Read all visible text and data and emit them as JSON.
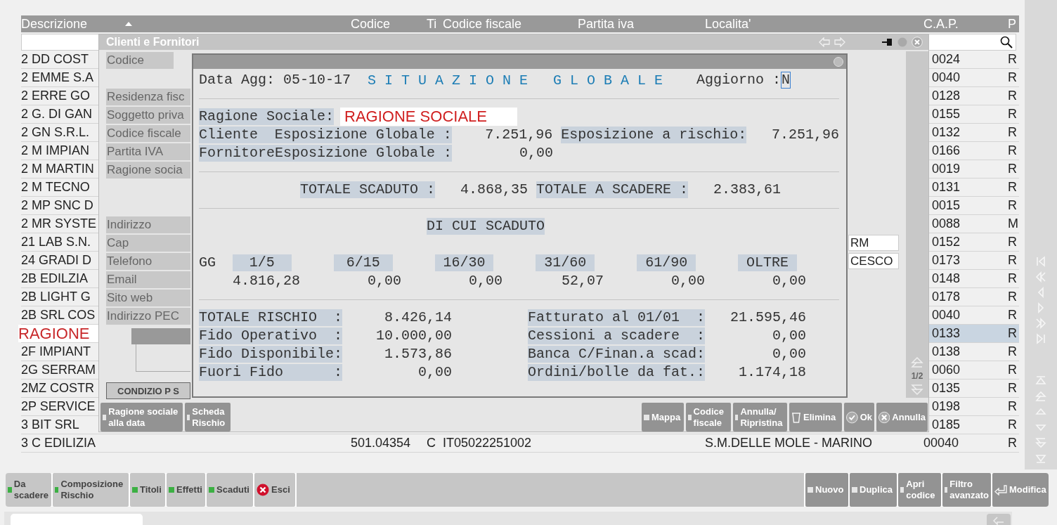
{
  "table": {
    "columns": [
      {
        "label": "Descrizione",
        "sorted": true
      },
      {
        "label": "Codice",
        "sorted": false
      },
      {
        "label": "Ti",
        "sorted": false
      },
      {
        "label": "Codice fiscale",
        "sorted": false
      },
      {
        "label": "Partita iva",
        "sorted": false
      },
      {
        "label": "Localita'",
        "sorted": false
      },
      {
        "label": "C.A.P.",
        "sorted": false
      },
      {
        "label": "P",
        "sorted": false
      }
    ],
    "rows": [
      {
        "description": "2 DD COST",
        "postal_code": "0024",
        "province": "R",
        "selected": false
      },
      {
        "description": "2 EMME S.A",
        "postal_code": "0040",
        "province": "R",
        "selected": false
      },
      {
        "description": "2 ERRE GO",
        "postal_code": "0128",
        "province": "R",
        "selected": false
      },
      {
        "description": "2 G. DI GAN",
        "postal_code": "0155",
        "province": "R",
        "selected": false
      },
      {
        "description": "2 GN S.R.L.",
        "postal_code": "0132",
        "province": "R",
        "selected": false
      },
      {
        "description": "2 M IMPIAN",
        "postal_code": "0166",
        "province": "R",
        "selected": false
      },
      {
        "description": "2 M MARTIN",
        "postal_code": "0019",
        "province": "R",
        "selected": false
      },
      {
        "description": "2 M TECNO",
        "postal_code": "0131",
        "province": "R",
        "selected": false
      },
      {
        "description": "2 MP SNC D",
        "postal_code": "0015",
        "province": "R",
        "selected": false
      },
      {
        "description": "2 MR SYSTE",
        "postal_code": "0088",
        "province": "M",
        "selected": false
      },
      {
        "description": "21 LAB S.N.",
        "postal_code": "0152",
        "province": "R",
        "selected": false
      },
      {
        "description": "24 GRADI D",
        "postal_code": "0173",
        "province": "R",
        "selected": false
      },
      {
        "description": "2B EDILZIA",
        "postal_code": "0148",
        "province": "R",
        "selected": false
      },
      {
        "description": "2B LIGHT G",
        "postal_code": "0178",
        "province": "R",
        "selected": false
      },
      {
        "description": "2B SRL COS",
        "postal_code": "0040",
        "province": "R",
        "selected": false
      },
      {
        "description": "RAGIONE",
        "postal_code": "0133",
        "province": "R",
        "selected": true
      },
      {
        "description": "2F IMPIANT",
        "postal_code": "0138",
        "province": "R",
        "selected": false
      },
      {
        "description": "2G SERRAM",
        "postal_code": "0060",
        "province": "R",
        "selected": false
      },
      {
        "description": "2MZ COSTR",
        "postal_code": "0135",
        "province": "R",
        "selected": false
      },
      {
        "description": "2P SERVICE",
        "postal_code": "0198",
        "province": "R",
        "selected": false
      },
      {
        "description": "3 BIT SRL",
        "postal_code": "0185",
        "province": "R",
        "selected": false
      },
      {
        "description": "3 C EDILIZIA",
        "code": "501.04354",
        "type": "C",
        "tax_code": "IT05022251002",
        "locality": "S.M.DELLE MOLE - MARINO",
        "postal_code": "00040",
        "province": "R",
        "selected": false
      }
    ]
  },
  "client_window": {
    "title": "Clienti e Fornitori",
    "field_groups": [
      [
        {
          "label": "Codice"
        }
      ],
      [
        {
          "label": "Residenza fisc"
        },
        {
          "label": "Soggetto priva"
        },
        {
          "label": "Codice fiscale"
        },
        {
          "label": "Partita IVA"
        },
        {
          "label": "Ragione socia"
        }
      ],
      [
        {
          "label": "Indirizzo"
        },
        {
          "label": "Cap",
          "value": "RM"
        },
        {
          "label": "Telefono",
          "value": "CESCO"
        },
        {
          "label": "Email"
        },
        {
          "label": "Sito web"
        },
        {
          "label": "Indirizzo PEC"
        }
      ]
    ],
    "condition_button": "CONDIZIO P S",
    "page": "1/2",
    "left_buttons": [
      {
        "label": "Ragione sociale alla data",
        "kind": "square",
        "disabled": true
      },
      {
        "label": "Scheda Rischio",
        "kind": "square",
        "disabled": true
      }
    ],
    "right_buttons": [
      {
        "label": "Mappa",
        "kind": "square",
        "disabled": true
      },
      {
        "label": "Codice fiscale",
        "kind": "square",
        "disabled": true
      },
      {
        "label": "Annulla/ Ripristina",
        "kind": "square",
        "disabled": true
      },
      {
        "label": "Elimina",
        "kind": "trash",
        "disabled": true
      },
      {
        "label": "Ok",
        "kind": "check",
        "disabled": true
      },
      {
        "label": "Annulla",
        "kind": "close",
        "disabled": true
      }
    ]
  },
  "risk_dialog": {
    "date_label": "Data Agg:",
    "date": "05-10-17",
    "title": "S I T U A Z I O N E   G L O B A L E",
    "update_label": "Aggiorno :",
    "update_value": "N",
    "company_label": "Ragione Sociale:",
    "company_name": "RAGIONE SOCIALE",
    "exposure_rows": [
      {
        "role": "Cliente",
        "label": "Esposizione Globale :",
        "value": "7.251,96",
        "risk_label": "Esposizione a rischio:",
        "risk_value": "7.251,96"
      },
      {
        "role": "Fornitore",
        "label": "Esposizione Globale :",
        "value": "0,00"
      }
    ],
    "totals": [
      {
        "label": "TOTALE SCADUTO :",
        "value": "4.868,35"
      },
      {
        "label": "TOTALE A SCADERE :",
        "value": "2.383,61"
      }
    ],
    "overdue": {
      "title": "DI CUI SCADUTO",
      "unit": "GG",
      "buckets": [
        {
          "label": "1/5",
          "value": "4.816,28"
        },
        {
          "label": "6/15",
          "value": "0,00"
        },
        {
          "label": "16/30",
          "value": "0,00"
        },
        {
          "label": "31/60",
          "value": "52,07"
        },
        {
          "label": "61/90",
          "value": "0,00"
        },
        {
          "label": "OLTRE",
          "value": "0,00"
        }
      ]
    },
    "summary": [
      {
        "label": "TOTALE RISCHIO  :",
        "value": "8.426,14",
        "right_label": "Fatturato al 01/01  :",
        "right_value": "21.595,46"
      },
      {
        "label": "Fido Operativo  :",
        "value": "10.000,00",
        "right_label": "Cessioni a scadere  :",
        "right_value": "0,00"
      },
      {
        "label": "Fido Disponibile:",
        "value": "1.573,86",
        "right_label": "Banca C/Finan.a scad:",
        "right_value": "0,00"
      },
      {
        "label": "Fuori Fido      :",
        "value": "0,00",
        "right_label": "Ordini/bolle da fat.:",
        "right_value": "1.174,18"
      }
    ]
  },
  "toolbar": {
    "left": [
      {
        "label": "Da scadere",
        "kind": "square",
        "disabled": false
      },
      {
        "label": "Composizione Rischio",
        "kind": "square",
        "disabled": false
      },
      {
        "label": "Titoli",
        "kind": "square",
        "disabled": false
      },
      {
        "label": "Effetti",
        "kind": "square",
        "disabled": false
      },
      {
        "label": "Scaduti",
        "kind": "square",
        "disabled": false
      },
      {
        "label": "Esci",
        "kind": "close",
        "disabled": false
      }
    ],
    "right": [
      {
        "label": "Nuovo",
        "kind": "square",
        "disabled": true
      },
      {
        "label": "Duplica",
        "kind": "square",
        "disabled": true
      },
      {
        "label": "Apri codice",
        "kind": "square",
        "disabled": true
      },
      {
        "label": "Filtro avanzato",
        "kind": "square",
        "disabled": true
      },
      {
        "label": "Modifica",
        "kind": "return",
        "disabled": true
      }
    ]
  }
}
